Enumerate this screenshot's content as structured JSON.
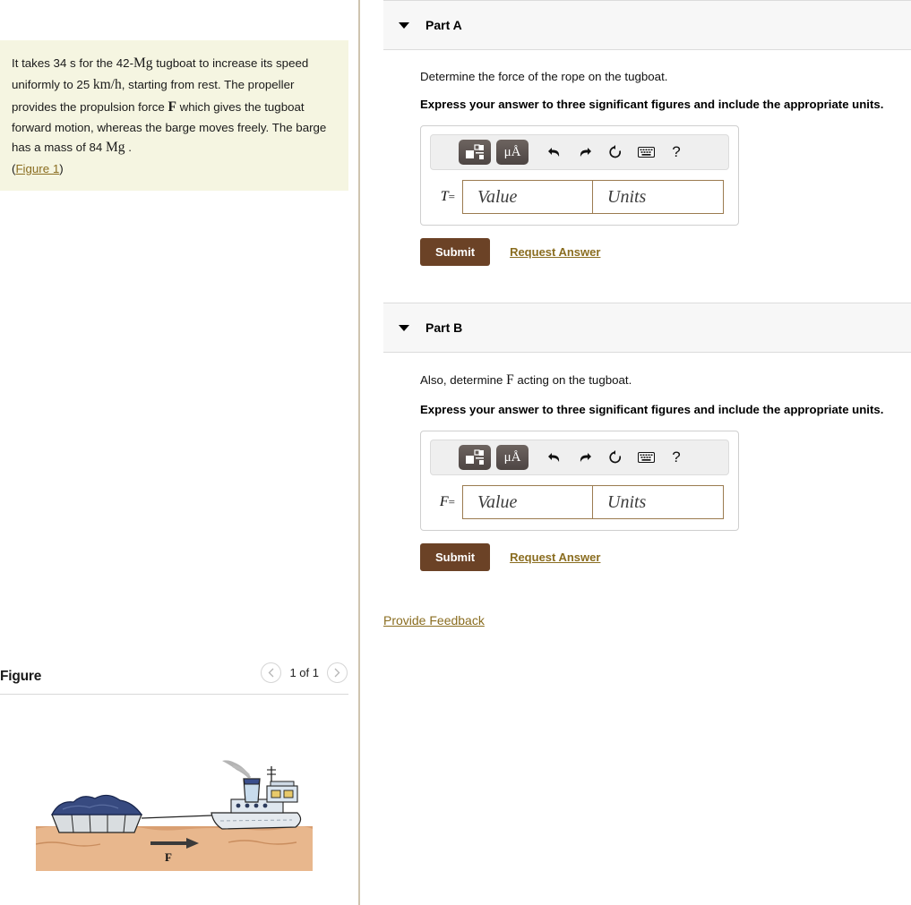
{
  "problem": {
    "text_segments": [
      "It takes 34 s for the 42-",
      "Mg",
      " tugboat to increase its speed uniformly to 25 ",
      "km/h",
      ", starting from rest. The propeller provides the propulsion force ",
      "F",
      " which gives the tugboat forward motion, whereas the barge moves freely. The barge has a mass of 84 ",
      "Mg",
      " ."
    ],
    "seg1": "It takes 34 s for the 42-",
    "unit_mg1": "Mg",
    "seg2": " tugboat to increase its speed uniformly to 25 ",
    "unit_kmh": "km/h",
    "seg3": ", starting from rest. The propeller provides the propulsion force ",
    "force_f": "F",
    "seg4": " which gives the tugboat forward motion, whereas the barge moves freely. The barge has a mass of 84 ",
    "unit_mg2": "Mg",
    "seg5": " .",
    "figure_link_open": "(",
    "figure_link": "Figure 1",
    "figure_link_close": ")"
  },
  "figure_panel": {
    "title": "Figure",
    "counter": "1 of 1",
    "prev_icon": "chevron-left",
    "next_icon": "chevron-right",
    "force_label": "F"
  },
  "parts": [
    {
      "id": "part-a",
      "header": "Part A",
      "question": "Determine the force of the rope on the tugboat.",
      "instruction": "Express your answer to three significant figures and include the appropriate units.",
      "variable": "T",
      "equals": "=",
      "value_placeholder": "Value",
      "units_placeholder": "Units",
      "submit_label": "Submit",
      "request_answer_label": "Request Answer",
      "toolbar": {
        "template_icon": "math-template-icon",
        "units_icon": "μÅ",
        "undo_icon": "undo-arrow",
        "redo_icon": "redo-arrow",
        "reset_icon": "reset-circular-arrow",
        "keyboard_icon": "keyboard",
        "help_icon": "?"
      }
    },
    {
      "id": "part-b",
      "header": "Part B",
      "question_pre": "Also, determine ",
      "question_var": "F",
      "question_post": " acting on the tugboat.",
      "instruction": "Express your answer to three significant figures and include the appropriate units.",
      "variable": "F",
      "equals": "=",
      "value_placeholder": "Value",
      "units_placeholder": "Units",
      "submit_label": "Submit",
      "request_answer_label": "Request Answer",
      "toolbar": {
        "template_icon": "math-template-icon",
        "units_icon": "μÅ",
        "undo_icon": "undo-arrow",
        "redo_icon": "redo-arrow",
        "reset_icon": "reset-circular-arrow",
        "keyboard_icon": "keyboard",
        "help_icon": "?"
      }
    }
  ],
  "footer": {
    "provide_feedback_label": "Provide Feedback"
  },
  "colors": {
    "problem_box_bg": "#f5f5e1",
    "link_brown": "#8a6d20",
    "submit_brown": "#6b4226",
    "part_header_bg": "#f7f7f7",
    "field_border": "#9b7b50"
  }
}
